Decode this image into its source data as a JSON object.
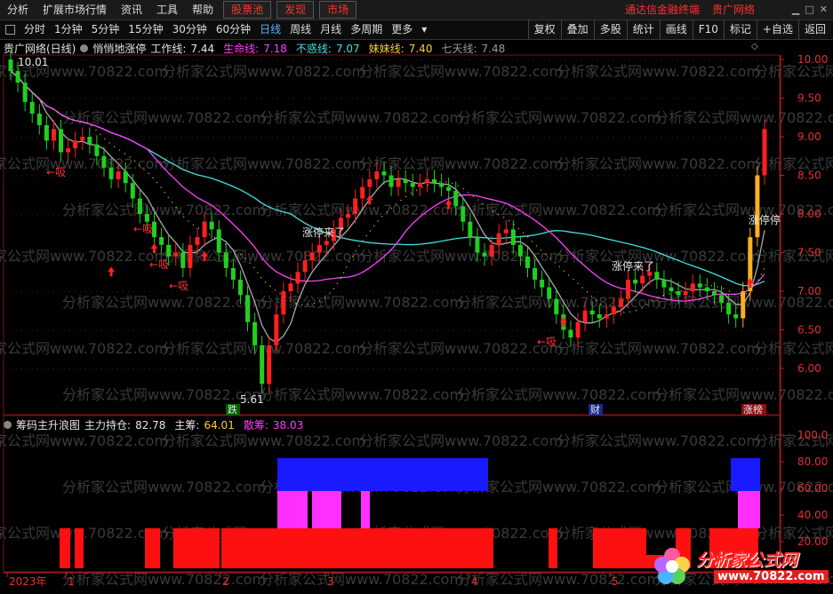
{
  "menu": {
    "items": [
      "分析",
      "扩展市场行情",
      "资讯",
      "工具",
      "帮助"
    ],
    "hot": [
      "股票池",
      "发现",
      "市场"
    ],
    "brand_left": "通达信金融终端",
    "brand_right": "贵广网络"
  },
  "toolbar": {
    "periods": [
      "分时",
      "1分钟",
      "5分钟",
      "15分钟",
      "30分钟",
      "60分钟",
      "日线",
      "周线",
      "月线",
      "多周期",
      "更多"
    ],
    "active": "日线",
    "right_buttons": [
      "复权",
      "叠加",
      "多股",
      "统计",
      "画线",
      "F10",
      "标记",
      "+自选",
      "返回"
    ]
  },
  "main_legend": {
    "stock": "贵广网络(日线)",
    "indicator": "悄悄地涨停",
    "items": [
      {
        "label": "工作线:",
        "value": "7.44",
        "color": "#e6e6e6"
      },
      {
        "label": "生命线:",
        "value": "7.18",
        "color": "#ff40ff"
      },
      {
        "label": "不惑线:",
        "value": "7.07",
        "color": "#40e0e0"
      },
      {
        "label": "妹妹线:",
        "value": "7.40",
        "color": "#ffcc33"
      },
      {
        "label": "七天线:",
        "value": "7.48",
        "color": "#999999"
      }
    ]
  },
  "sub_legend": {
    "indicator": "筹码主升浪图",
    "items": [
      {
        "label": "主力持仓:",
        "value": "82.78",
        "color": "#e6e6e6"
      },
      {
        "label": "主筹:",
        "value": "64.01",
        "color": "#ffcc33"
      },
      {
        "label": "散筹:",
        "value": "38.03",
        "color": "#ff40ff"
      }
    ]
  },
  "price_axis": [
    "10.00",
    "9.50",
    "9.00",
    "8.50",
    "8.00",
    "7.50",
    "7.00",
    "6.50",
    "6.00"
  ],
  "sub_axis": [
    "100.0",
    "80.00",
    "60.00",
    "40.00",
    "20.00"
  ],
  "annotations": {
    "high": "10.01",
    "low": "5.61",
    "xi": "←吸",
    "zhangting_lai": "涨停来了",
    "zhangting": "涨停停",
    "die": "跌",
    "cai": "财",
    "zhangbang": "涨榜"
  },
  "x_axis": [
    "2023年",
    "1",
    "2",
    "3",
    "4",
    "5"
  ],
  "watermark": "分析家公式网www.70822.com",
  "logo": {
    "title": "分析家公式网",
    "url": "www.70822.com"
  }
}
